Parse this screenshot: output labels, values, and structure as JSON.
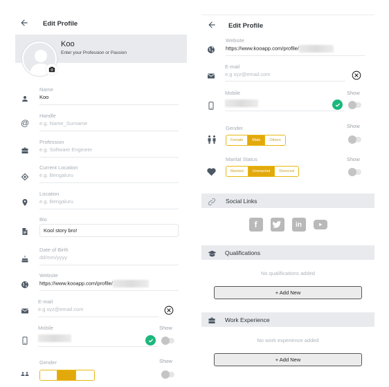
{
  "left": {
    "header": {
      "title": "Edit Profile"
    },
    "profile": {
      "name": "Koo",
      "subtitle": "Enter your Profession or Passion"
    },
    "fields": {
      "name": {
        "label": "Name",
        "value": "Koo"
      },
      "handle": {
        "label": "Handle",
        "placeholder": "e.g. Name_Surname"
      },
      "profession": {
        "label": "Profession",
        "placeholder": "e.g. Software Engineer"
      },
      "current_location": {
        "label": "Current Location",
        "placeholder": "e.g. Bengaluru"
      },
      "location": {
        "label": "Location",
        "placeholder": "e.g. Bengaluru"
      },
      "bio": {
        "label": "Bio",
        "value": "Kool story bro!"
      },
      "dob": {
        "label": "Date of Birth",
        "placeholder": "dd/mm/yyyy"
      },
      "website": {
        "label": "Website",
        "value": "https://www.kooapp.com/profile/"
      },
      "email": {
        "label": "E-mail",
        "placeholder": "e.g xyz@email.com"
      },
      "mobile": {
        "label": "Mobile",
        "show_label": "Show",
        "verified": true,
        "show": false
      },
      "gender": {
        "label": "Gender",
        "show_label": "Show"
      }
    }
  },
  "right": {
    "header": {
      "title": "Edit Profile"
    },
    "fields": {
      "website": {
        "label": "Website",
        "value": "https://www.kooapp.com/profile/"
      },
      "email": {
        "label": "E-mail",
        "placeholder": "e.g xyz@email.com"
      },
      "mobile": {
        "label": "Mobile",
        "show_label": "Show",
        "verified": true,
        "show": false
      },
      "gender": {
        "label": "Gender",
        "show_label": "Show",
        "options": [
          "Female",
          "Male",
          "Others"
        ],
        "selected": "Male",
        "show": false
      },
      "marital": {
        "label": "Marital Status",
        "show_label": "Show",
        "options": [
          "Married",
          "Unmarried",
          "Divorced"
        ],
        "selected": "Unmarried",
        "show": false
      }
    },
    "social_links": {
      "title": "Social Links",
      "icons": [
        "facebook-icon",
        "twitter-icon",
        "linkedin-icon",
        "youtube-icon"
      ]
    },
    "qualifications": {
      "title": "Qualifications",
      "empty": "No qualifications added",
      "add_label": "+ Add New"
    },
    "work_experience": {
      "title": "Work Experience",
      "empty": "No work experience added",
      "add_label": "+ Add New"
    }
  },
  "colors": {
    "accent": "#e3a90c",
    "verified": "#1cb77c",
    "section_bg": "#e8eaed"
  }
}
